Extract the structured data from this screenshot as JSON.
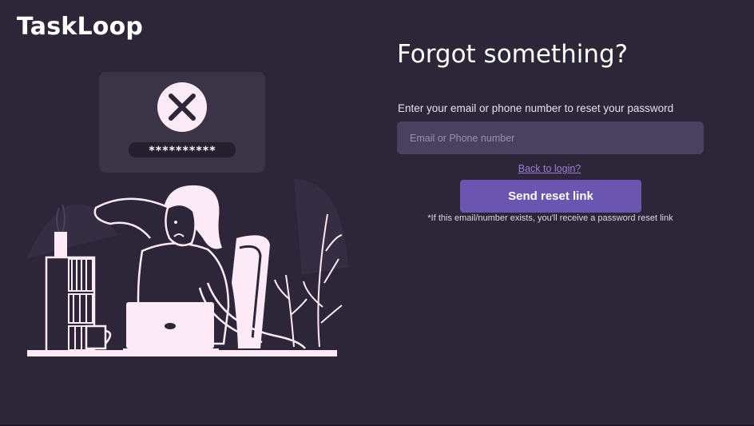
{
  "brand": {
    "name": "TaskLoop"
  },
  "illustration": {
    "icon": "x-mark-icon",
    "masked_password": "**********",
    "colors": {
      "ink": "#fcebf7",
      "card": "#3b3346",
      "line": "#f4e9f4"
    }
  },
  "form": {
    "title": "Forgot something?",
    "instructions": "Enter your email or phone number to reset your password",
    "email": {
      "placeholder": "Email or Phone number",
      "value": ""
    },
    "back_link": "Back to login?",
    "submit_label": "Send reset link",
    "note": "*If this email/number exists, you'll receive a password reset link"
  },
  "colors": {
    "background": "#2d2638",
    "input_bg": "#4a4160",
    "accent": "#6a55b0",
    "link": "#9b7fd6"
  }
}
